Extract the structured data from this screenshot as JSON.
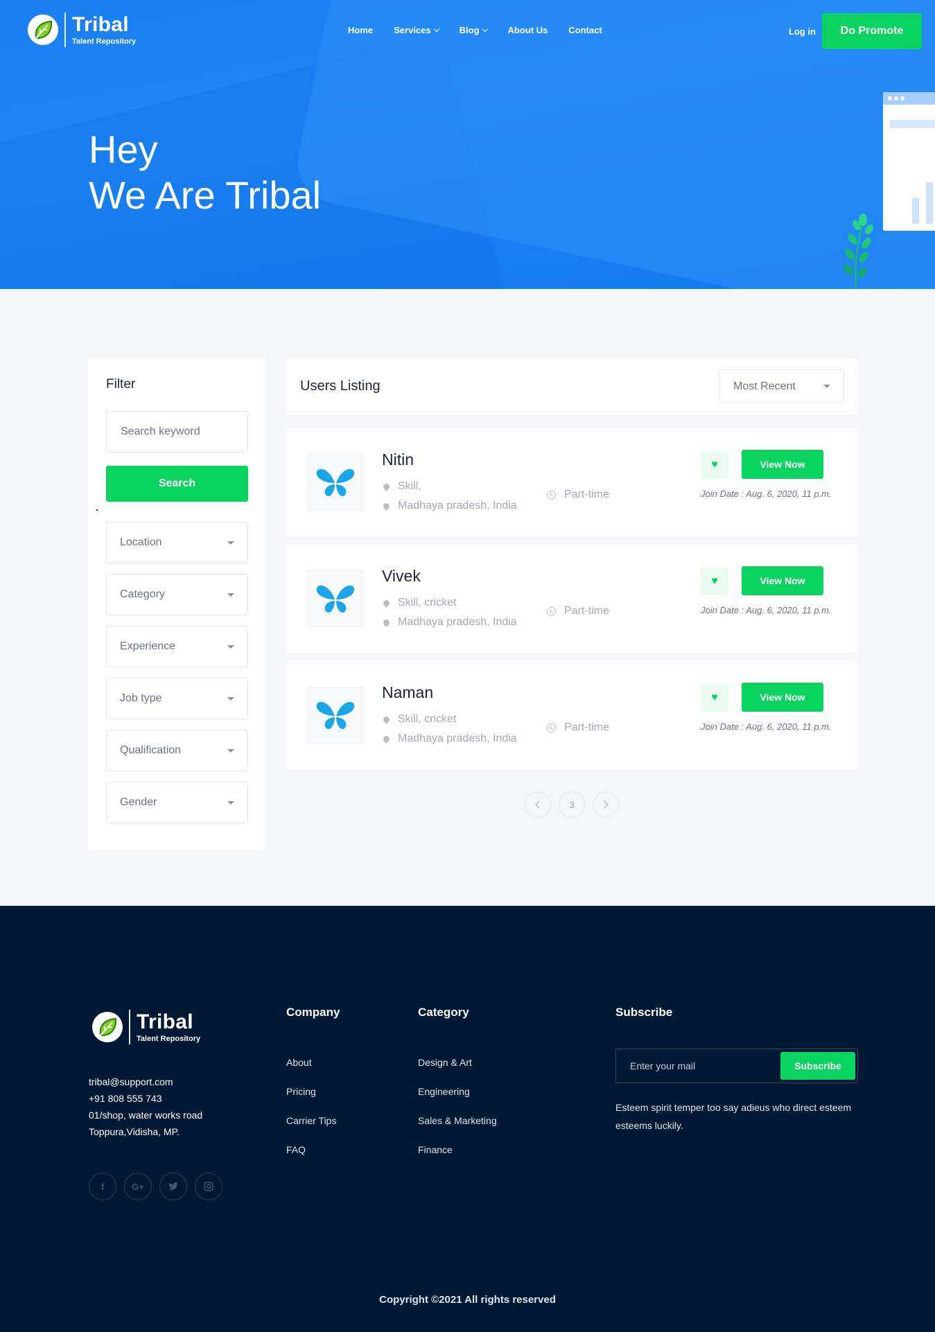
{
  "brand": {
    "name": "Tribal",
    "tagline": "Talent Repository"
  },
  "nav": {
    "items": [
      "Home",
      "Services",
      "Blog",
      "About Us",
      "Contact"
    ],
    "login": "Log in",
    "promote": "Do Promote"
  },
  "hero": {
    "line1": "Hey",
    "line2": "We Are Tribal"
  },
  "filter": {
    "title": "Filter",
    "search_placeholder": "Search keyword",
    "search_button": "Search",
    "selects": [
      "Location",
      "Category",
      "Experience",
      "Job type",
      "Qualification",
      "Gender"
    ]
  },
  "listing": {
    "title": "Users Listing",
    "sort": "Most Recent",
    "users": [
      {
        "name": "Nitin",
        "skill": "Skill,",
        "location": "Madhaya pradesh, India",
        "type": "Part-time",
        "join": "Join Date : Aug. 6, 2020, 11 p.m.",
        "view": "View Now"
      },
      {
        "name": "Vivek",
        "skill": "Skill, cricket",
        "location": "Madhaya pradesh, India",
        "type": "Part-time",
        "join": "Join Date : Aug. 6, 2020, 11 p.m.",
        "view": "View Now"
      },
      {
        "name": "Naman",
        "skill": "Skill, cricket",
        "location": "Madhaya pradesh, India",
        "type": "Part-time",
        "join": "Join Date : Aug. 6, 2020, 11 p.m.",
        "view": "View Now"
      }
    ],
    "page": "3"
  },
  "footer": {
    "contact": [
      "tribal@support.com",
      "+91 808 555 743",
      "01/shop, water works road",
      "Toppura,Vidisha, MP."
    ],
    "social_icons": [
      "facebook-icon",
      "google-plus-icon",
      "twitter-icon",
      "instagram-icon"
    ],
    "company": {
      "title": "Company",
      "links": [
        "About",
        "Pricing",
        "Carrier Tips",
        "FAQ"
      ]
    },
    "category": {
      "title": "Category",
      "links": [
        "Design & Art",
        "Engineering",
        "Sales & Marketing",
        "Finance"
      ]
    },
    "subscribe": {
      "title": "Subscribe",
      "placeholder": "Enter your mail",
      "button": "Subscribe",
      "text": "Esteem spirit temper too say adieus who direct esteem esteems luckily."
    },
    "copyright": "Copyright ©2021 All rights reserved"
  },
  "colors": {
    "primary_blue": "#1a7ff0",
    "accent_green": "#0bd35f",
    "footer_bg": "#001a35"
  }
}
